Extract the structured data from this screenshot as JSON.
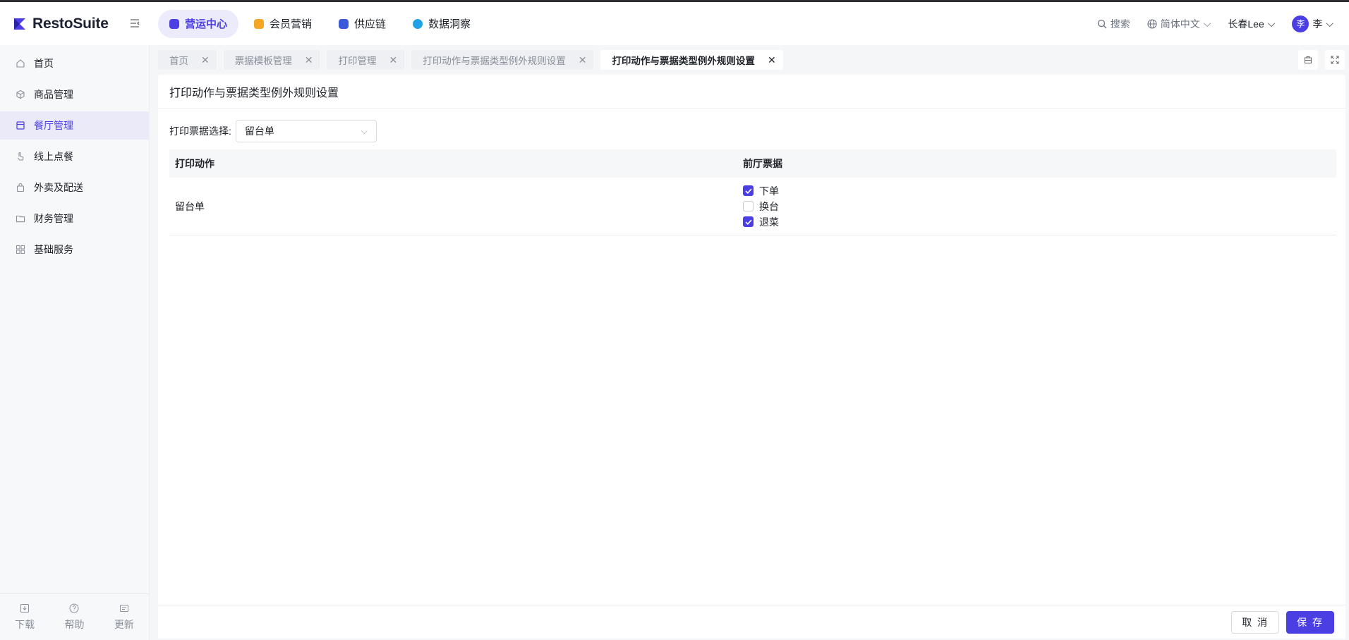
{
  "app": {
    "brand": "RestoSuite"
  },
  "topnav": [
    {
      "label": "营运中心",
      "color": "#4b3fe4"
    },
    {
      "label": "会员营销",
      "color": "#f5a623"
    },
    {
      "label": "供应链",
      "color": "#3b5bdb"
    },
    {
      "label": "数据洞察",
      "color": "#22a3e8"
    }
  ],
  "header": {
    "search": "搜索",
    "language": "简体中文",
    "store": "长春Lee",
    "avatar_char": "李",
    "user": "李"
  },
  "sidebar": {
    "items": [
      {
        "label": "首页"
      },
      {
        "label": "商品管理"
      },
      {
        "label": "餐厅管理"
      },
      {
        "label": "线上点餐"
      },
      {
        "label": "外卖及配送"
      },
      {
        "label": "财务管理"
      },
      {
        "label": "基础服务"
      }
    ],
    "bottom": [
      {
        "label": "下载"
      },
      {
        "label": "帮助"
      },
      {
        "label": "更新"
      }
    ]
  },
  "tabs": [
    {
      "label": "首页"
    },
    {
      "label": "票据模板管理"
    },
    {
      "label": "打印管理"
    },
    {
      "label": "打印动作与票据类型例外规则设置"
    },
    {
      "label": "打印动作与票据类型例外规则设置"
    }
  ],
  "page": {
    "title": "打印动作与票据类型例外规则设置",
    "filter_label": "打印票据选择:",
    "filter_value": "留台单"
  },
  "table": {
    "columns": [
      "打印动作",
      "前厅票据"
    ],
    "rows": [
      {
        "action": "留台单",
        "options": [
          {
            "label": "下单",
            "checked": true
          },
          {
            "label": "换台",
            "checked": false
          },
          {
            "label": "退菜",
            "checked": true
          }
        ]
      }
    ]
  },
  "footer": {
    "cancel": "取 消",
    "save": "保 存"
  }
}
